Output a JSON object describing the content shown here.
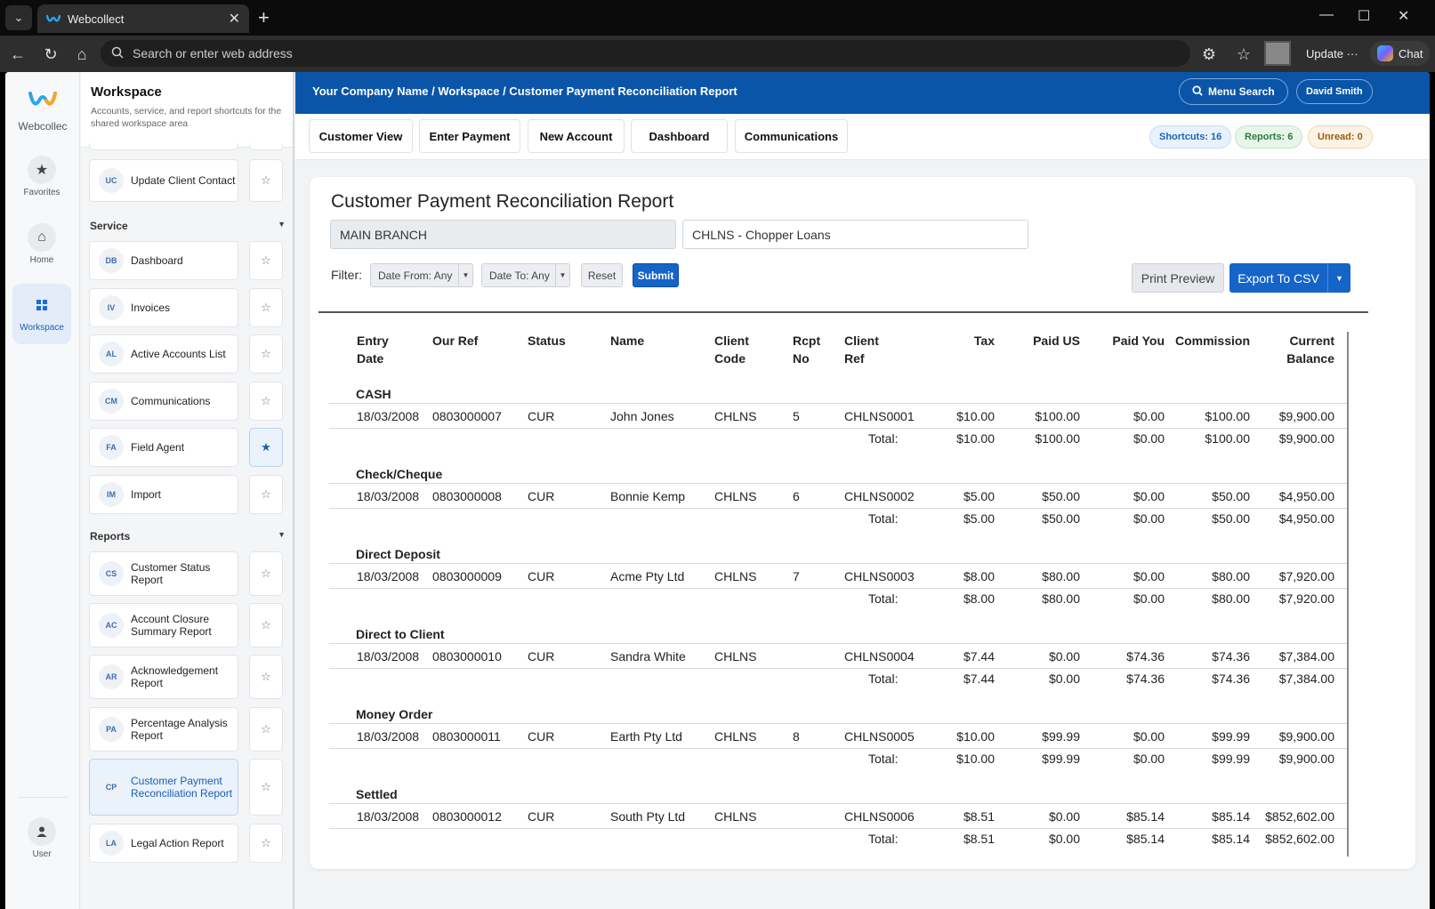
{
  "browser": {
    "tab_title": "Webcollect",
    "url_placeholder": "Search or enter web address",
    "update_label": "Update",
    "chat_label": "Chat"
  },
  "rail": {
    "brand": "Webcollec",
    "items": [
      {
        "label": "Favorites",
        "icon": "star-icon"
      },
      {
        "label": "Home",
        "icon": "home-icon"
      },
      {
        "label": "Workspace",
        "icon": "grid-icon"
      },
      {
        "label": "User",
        "icon": "user-icon"
      }
    ]
  },
  "sidebar": {
    "title": "Workspace",
    "description": "Accounts, service, and report shortcuts for the shared workspace area",
    "top_items": [
      {
        "code": "UC",
        "label": "Update Client Contact",
        "starred": false
      }
    ],
    "sections": [
      {
        "title": "Service",
        "items": [
          {
            "code": "DB",
            "label": "Dashboard",
            "starred": false
          },
          {
            "code": "IV",
            "label": "Invoices",
            "starred": false
          },
          {
            "code": "AL",
            "label": "Active Accounts List",
            "starred": false
          },
          {
            "code": "CM",
            "label": "Communications",
            "starred": false
          },
          {
            "code": "FA",
            "label": "Field Agent",
            "starred": true
          },
          {
            "code": "IM",
            "label": "Import",
            "starred": false
          }
        ]
      },
      {
        "title": "Reports",
        "items": [
          {
            "code": "CS",
            "label": "Customer Status Report",
            "starred": false
          },
          {
            "code": "AC",
            "label": "Account Closure Summary Report",
            "starred": false
          },
          {
            "code": "AR",
            "label": "Acknowledgement Report",
            "starred": false
          },
          {
            "code": "PA",
            "label": "Percentage Analysis Report",
            "starred": false
          },
          {
            "code": "CP",
            "label": "Customer Payment Reconciliation Report",
            "starred": false,
            "active": true
          },
          {
            "code": "LA",
            "label": "Legal Action Report",
            "starred": false
          }
        ]
      }
    ]
  },
  "header": {
    "breadcrumb": "Your Company Name / Workspace / Customer Payment Reconciliation Report",
    "menu_search": "Menu Search",
    "user": "David Smith"
  },
  "quick_links": [
    "Customer View",
    "Enter Payment",
    "New Account",
    "Dashboard",
    "Communications"
  ],
  "counters": {
    "shortcuts": "Shortcuts: 16",
    "reports": "Reports: 6",
    "unread": "Unread: 0"
  },
  "report": {
    "title": "Customer Payment Reconciliation Report",
    "branch": "MAIN BRANCH",
    "client": "CHLNS - Chopper Loans",
    "filter_label": "Filter:",
    "date_from": "Date From: Any",
    "date_to": "Date To: Any",
    "reset": "Reset",
    "submit": "Submit",
    "print_preview": "Print Preview",
    "export": "Export To CSV",
    "total_label": "Total:",
    "columns": [
      {
        "l1": "Entry",
        "l2": "Date"
      },
      {
        "l1": "Our Ref",
        "l2": ""
      },
      {
        "l1": "Status",
        "l2": ""
      },
      {
        "l1": "Name",
        "l2": ""
      },
      {
        "l1": "Client",
        "l2": "Code"
      },
      {
        "l1": "Rcpt",
        "l2": "No"
      },
      {
        "l1": "Client",
        "l2": "Ref"
      },
      {
        "l1": "Tax",
        "l2": ""
      },
      {
        "l1": "Paid US",
        "l2": ""
      },
      {
        "l1": "Paid You",
        "l2": ""
      },
      {
        "l1": "Commission",
        "l2": ""
      },
      {
        "l1": "Current",
        "l2": "Balance"
      }
    ],
    "groups": [
      {
        "name": "CASH",
        "row": [
          "18/03/2008",
          "0803000007",
          "CUR",
          "John Jones",
          "CHLNS",
          "5",
          "CHLNS0001",
          "$10.00",
          "$100.00",
          "$0.00",
          "$100.00",
          "$9,900.00"
        ],
        "total": [
          "$10.00",
          "$100.00",
          "$0.00",
          "$100.00",
          "$9,900.00"
        ]
      },
      {
        "name": "Check/Cheque",
        "row": [
          "18/03/2008",
          "0803000008",
          "CUR",
          "Bonnie Kemp",
          "CHLNS",
          "6",
          "CHLNS0002",
          "$5.00",
          "$50.00",
          "$0.00",
          "$50.00",
          "$4,950.00"
        ],
        "total": [
          "$5.00",
          "$50.00",
          "$0.00",
          "$50.00",
          "$4,950.00"
        ]
      },
      {
        "name": "Direct Deposit",
        "row": [
          "18/03/2008",
          "0803000009",
          "CUR",
          "Acme Pty Ltd",
          "CHLNS",
          "7",
          "CHLNS0003",
          "$8.00",
          "$80.00",
          "$0.00",
          "$80.00",
          "$7,920.00"
        ],
        "total": [
          "$8.00",
          "$80.00",
          "$0.00",
          "$80.00",
          "$7,920.00"
        ]
      },
      {
        "name": "Direct to Client",
        "row": [
          "18/03/2008",
          "0803000010",
          "CUR",
          "Sandra White",
          "CHLNS",
          "",
          "CHLNS0004",
          "$7.44",
          "$0.00",
          "$74.36",
          "$74.36",
          "$7,384.00"
        ],
        "total": [
          "$7.44",
          "$0.00",
          "$74.36",
          "$74.36",
          "$7,384.00"
        ]
      },
      {
        "name": "Money Order",
        "row": [
          "18/03/2008",
          "0803000011",
          "CUR",
          "Earth Pty Ltd",
          "CHLNS",
          "8",
          "CHLNS0005",
          "$10.00",
          "$99.99",
          "$0.00",
          "$99.99",
          "$9,900.00"
        ],
        "total": [
          "$10.00",
          "$99.99",
          "$0.00",
          "$99.99",
          "$9,900.00"
        ]
      },
      {
        "name": "Settled",
        "row": [
          "18/03/2008",
          "0803000012",
          "CUR",
          "South Pty Ltd",
          "CHLNS",
          "",
          "CHLNS0006",
          "$8.51",
          "$0.00",
          "$85.14",
          "$85.14",
          "$852,602.00"
        ],
        "total": [
          "$8.51",
          "$0.00",
          "$85.14",
          "$85.14",
          "$852,602.00"
        ]
      }
    ]
  }
}
